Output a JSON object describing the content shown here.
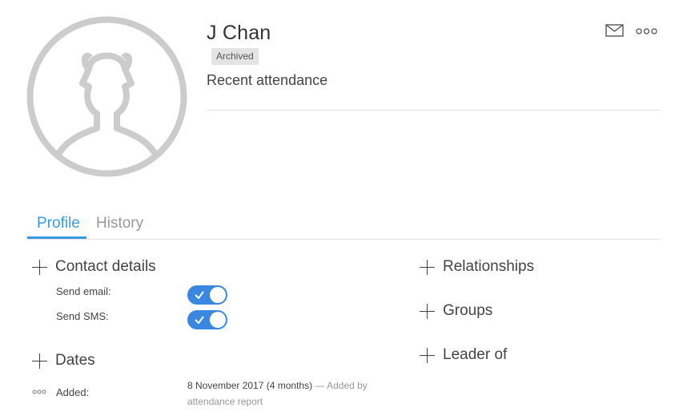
{
  "person": {
    "name": "J Chan",
    "status_badge": "Archived",
    "subtitle": "Recent attendance"
  },
  "header_actions": {
    "email_icon": "envelope-icon",
    "more_icon": "ellipsis-icon"
  },
  "tabs": [
    {
      "label": "Profile",
      "active": true
    },
    {
      "label": "History",
      "active": false
    }
  ],
  "contact": {
    "title": "Contact details",
    "send_email_label": "Send email:",
    "send_email_on": true,
    "send_sms_label": "Send SMS:",
    "send_sms_on": true
  },
  "dates": {
    "title": "Dates",
    "added_label": "Added:",
    "added_value": "8 November 2017 (4 months)",
    "added_note": "— Added by attendance report"
  },
  "right_sections": [
    {
      "title": "Relationships"
    },
    {
      "title": "Groups"
    },
    {
      "title": "Leader of"
    }
  ],
  "colors": {
    "accent": "#3a9ae0",
    "toggle_on": "#3a87e0",
    "badge_bg": "#e4e4e4",
    "avatar_gray": "#cccccc"
  }
}
